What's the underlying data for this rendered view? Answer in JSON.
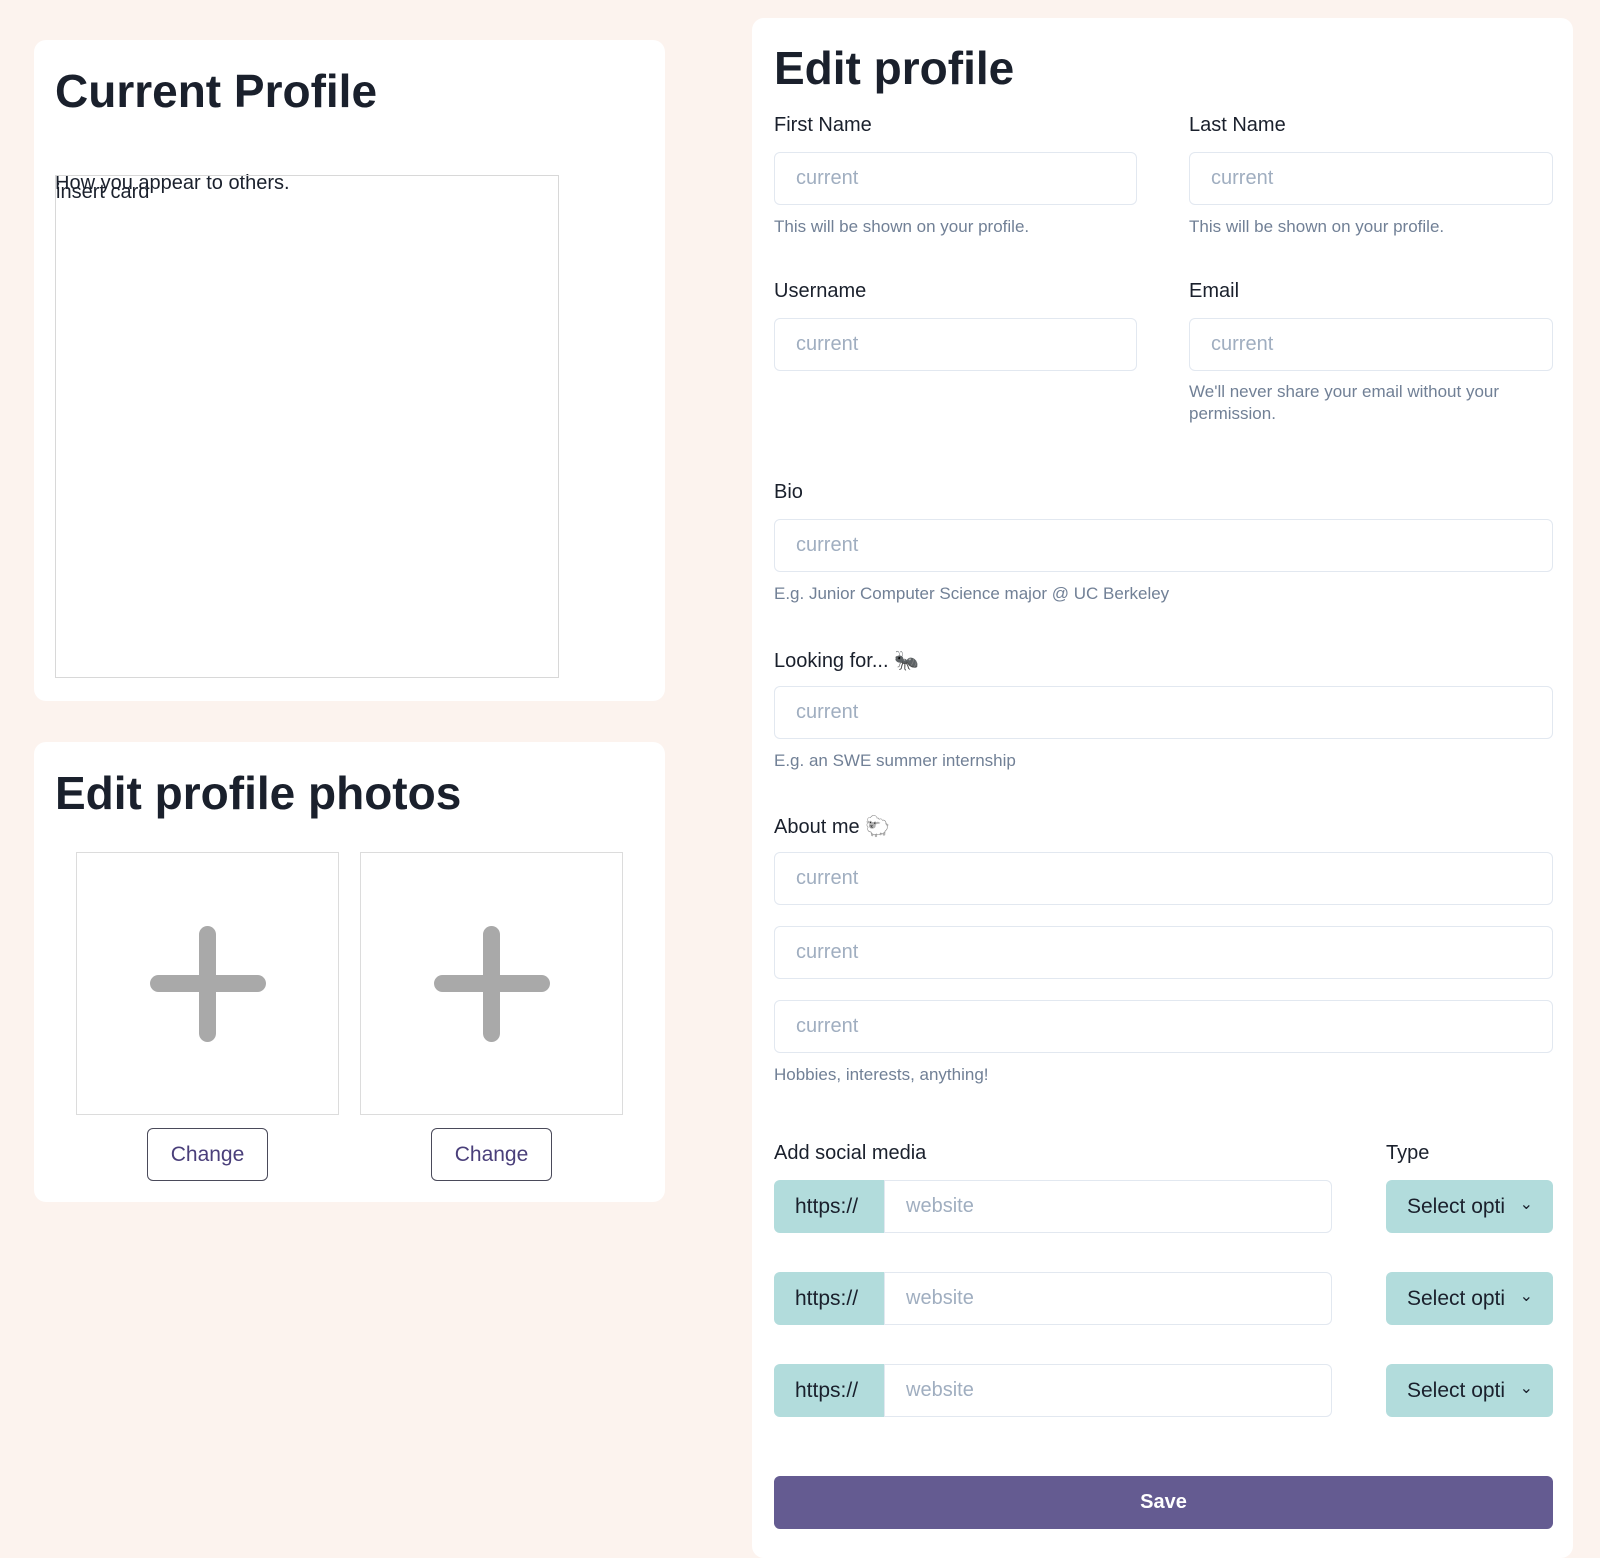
{
  "current_profile": {
    "title": "Current Profile",
    "subtitle": "How you appear to others.",
    "card_placeholder": "insert card"
  },
  "photos": {
    "title": "Edit profile photos",
    "slots": [
      {
        "icon": "plus-icon",
        "button_label": "Change"
      },
      {
        "icon": "plus-icon",
        "button_label": "Change"
      }
    ]
  },
  "edit_profile": {
    "title": "Edit profile",
    "first_name": {
      "label": "First Name",
      "placeholder": "current",
      "help": "This will be shown on your profile."
    },
    "last_name": {
      "label": "Last Name",
      "placeholder": "current",
      "help": "This will be shown on your profile."
    },
    "username": {
      "label": "Username",
      "placeholder": "current"
    },
    "email": {
      "label": "Email",
      "placeholder": "current",
      "help": "We'll never share your email without your permission."
    },
    "bio": {
      "label": "Bio",
      "placeholder": "current",
      "help": "E.g. Junior Computer Science major @ UC Berkeley"
    },
    "looking_for": {
      "label": "Looking for... 🐜",
      "placeholder": "current",
      "help": "E.g. an SWE summer internship"
    },
    "about_me": {
      "label": "About me 🐑",
      "fields": [
        {
          "placeholder": "current"
        },
        {
          "placeholder": "current"
        },
        {
          "placeholder": "current"
        }
      ],
      "help": "Hobbies, interests, anything!"
    },
    "social": {
      "label": "Add social media",
      "type_label": "Type",
      "rows": [
        {
          "prefix": "https://",
          "placeholder": "website",
          "select": "Select opti"
        },
        {
          "prefix": "https://",
          "placeholder": "website",
          "select": "Select opti"
        },
        {
          "prefix": "https://",
          "placeholder": "website",
          "select": "Select opti"
        }
      ]
    },
    "save_label": "Save"
  },
  "colors": {
    "background": "#fcf3ee",
    "card": "#ffffff",
    "accent": "#645b91",
    "addon": "#b2dcdc",
    "help_text": "#718096"
  }
}
